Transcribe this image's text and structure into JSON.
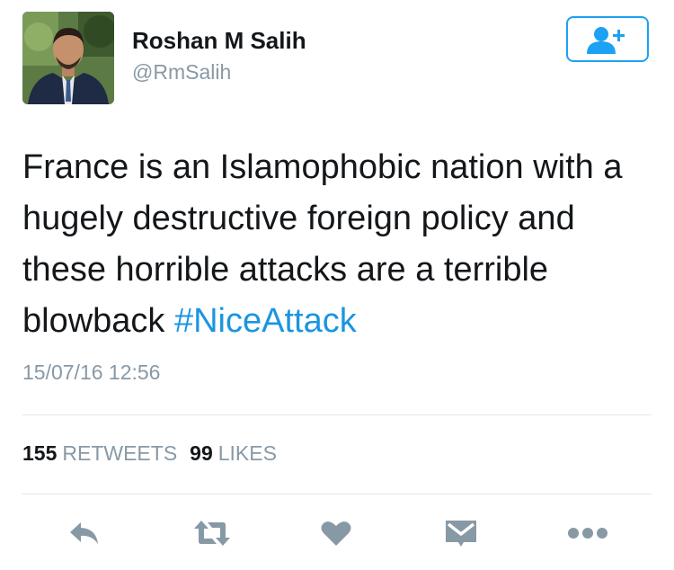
{
  "author": {
    "display_name": "Roshan M Salih",
    "handle": "@RmSalih"
  },
  "follow_button": {
    "icon": "follow-person-plus-icon"
  },
  "tweet": {
    "text": "France is an Islamophobic nation with a hugely destructive foreign policy and these horrible attacks are a terrible blowback",
    "hashtag": "#NiceAttack",
    "timestamp": "15/07/16 12:56"
  },
  "stats": {
    "retweets_count": "155",
    "retweets_label": "RETWEETS",
    "likes_count": "99",
    "likes_label": "LIKES"
  },
  "actions": [
    {
      "name": "reply",
      "icon": "reply-arrow-icon"
    },
    {
      "name": "retweet",
      "icon": "retweet-icon"
    },
    {
      "name": "like",
      "icon": "heart-icon"
    },
    {
      "name": "message",
      "icon": "envelope-icon"
    },
    {
      "name": "more",
      "icon": "more-dots-icon"
    }
  ],
  "colors": {
    "brand_blue": "#1da1f2",
    "hashtag_blue": "#1b95e0",
    "muted_gray": "#8899a6",
    "icon_gray": "#8899a6",
    "divider": "#e1e8ed",
    "text": "#14171a"
  }
}
